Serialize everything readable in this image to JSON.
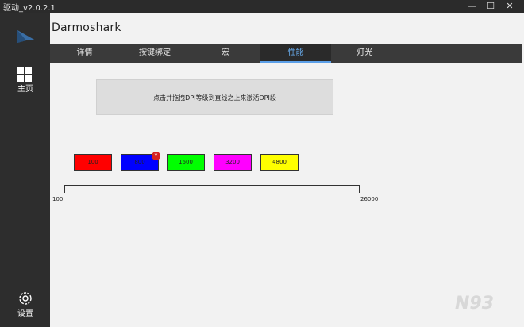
{
  "window": {
    "title": "驱动_v2.0.2.1",
    "min_glyph": "—",
    "max_glyph": "☐",
    "close_glyph": "✕"
  },
  "brand": {
    "name": "Darmoshark"
  },
  "sidebar": {
    "home_label": "主页",
    "settings_label": "设置"
  },
  "tabs": [
    {
      "label": "详情"
    },
    {
      "label": "按键绑定"
    },
    {
      "label": "宏"
    },
    {
      "label": "性能",
      "active": true
    },
    {
      "label": "灯光"
    }
  ],
  "hint": {
    "text": "点击并拖拽DPI等级到直线之上来激活DPI段"
  },
  "dpi_levels": [
    {
      "value": "100",
      "color": "#ff0000"
    },
    {
      "value": "800",
      "color": "#0000ff",
      "badge": "Y"
    },
    {
      "value": "1600",
      "color": "#00ff00"
    },
    {
      "value": "3200",
      "color": "#ff00ff"
    },
    {
      "value": "4800",
      "color": "#ffff00"
    }
  ],
  "slider": {
    "min_label": "100",
    "max_label": "26000"
  },
  "watermark": {
    "text": "N93"
  }
}
